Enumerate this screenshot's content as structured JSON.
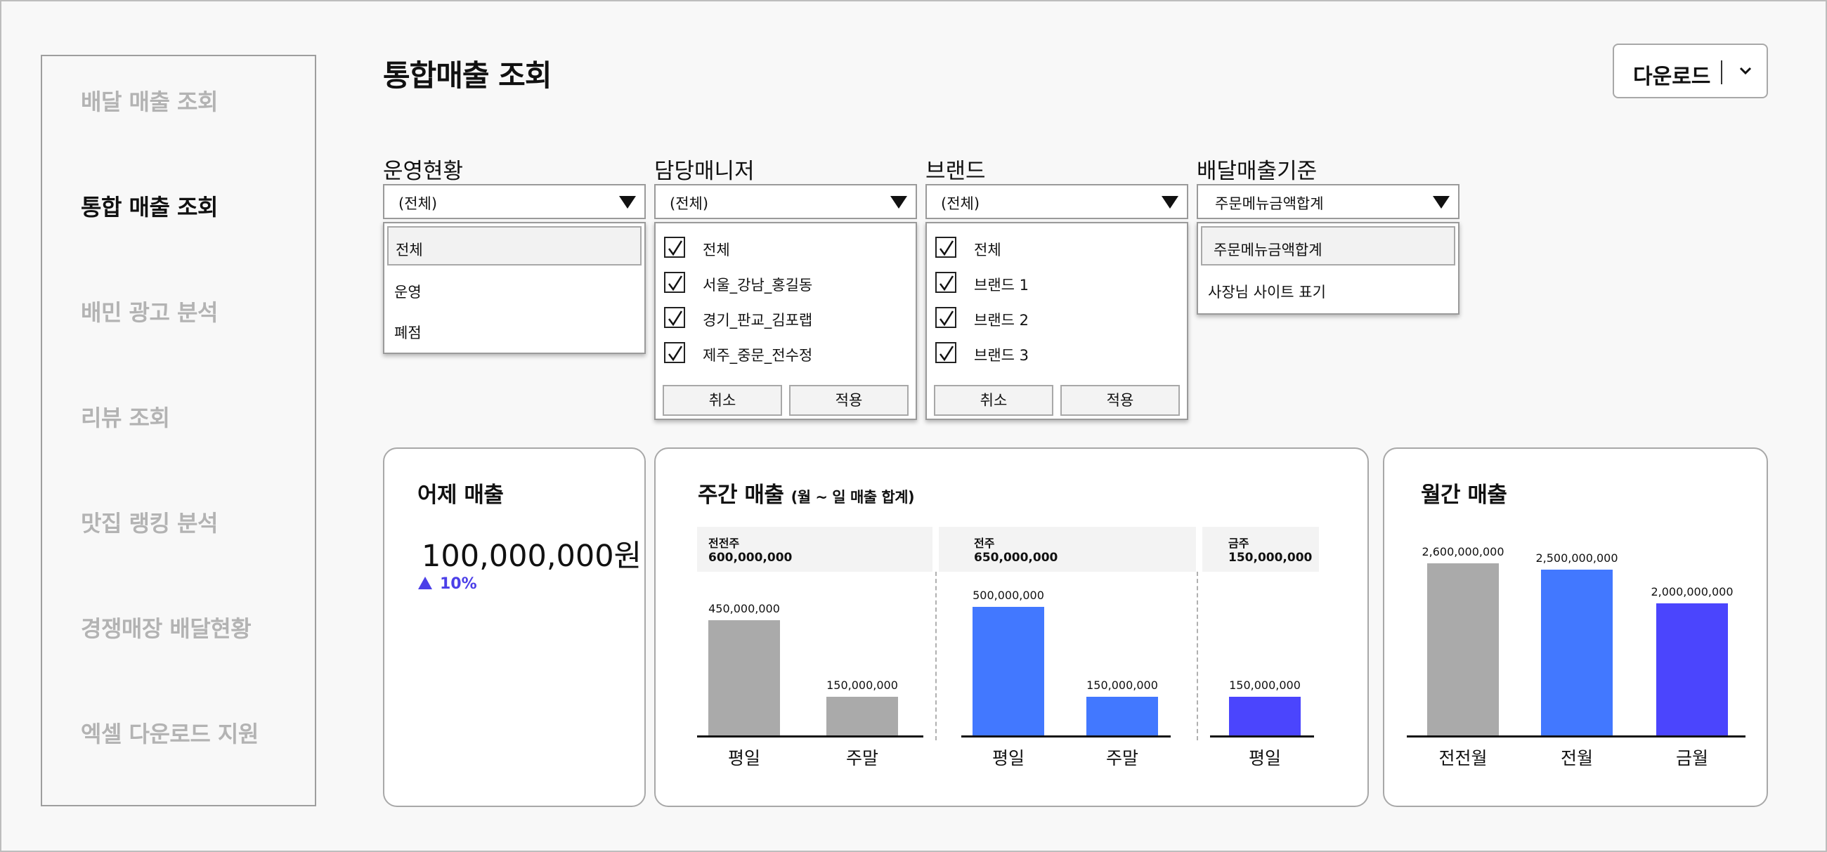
{
  "sidebar": {
    "items": [
      {
        "label": "배달 매출 조회",
        "active": false
      },
      {
        "label": "통합 매출 조회",
        "active": true
      },
      {
        "label": "배민 광고 분석",
        "active": false
      },
      {
        "label": "리뷰 조회",
        "active": false
      },
      {
        "label": "맛집 랭킹 분석",
        "active": false
      },
      {
        "label": "경쟁매장 배달현황",
        "active": false
      },
      {
        "label": "엑셀 다운로드 지원",
        "active": false
      }
    ]
  },
  "header": {
    "title": "통합매출 조회",
    "download_label": "다운로드"
  },
  "filters": {
    "status": {
      "label": "운영현황",
      "value": "(전체)",
      "options": [
        {
          "label": "전체",
          "selected": true
        },
        {
          "label": "운영",
          "selected": false
        },
        {
          "label": "폐점",
          "selected": false
        }
      ]
    },
    "manager": {
      "label": "담당매니저",
      "value": "(전체)",
      "options": [
        {
          "label": "전체",
          "checked": true
        },
        {
          "label": "서울_강남_홍길동",
          "checked": true
        },
        {
          "label": "경기_판교_김포랩",
          "checked": true
        },
        {
          "label": "제주_중문_전수정",
          "checked": true
        }
      ],
      "cancel": "취소",
      "apply": "적용"
    },
    "brand": {
      "label": "브랜드",
      "value": "(전체)",
      "options": [
        {
          "label": "전체",
          "checked": true
        },
        {
          "label": "브랜드 1",
          "checked": true
        },
        {
          "label": "브랜드 2",
          "checked": true
        },
        {
          "label": "브랜드 3",
          "checked": true
        }
      ],
      "cancel": "취소",
      "apply": "적용"
    },
    "basis": {
      "label": "배달매출기준",
      "value": "주문메뉴금액합계",
      "options": [
        {
          "label": "주문메뉴금액합계",
          "selected": true
        },
        {
          "label": "사장님 사이트 표기",
          "selected": false
        }
      ]
    }
  },
  "yesterday": {
    "title": "어제 매출",
    "value": "100,000,000원",
    "delta": "10%",
    "delta_color": "#4b3fe8"
  },
  "weekly": {
    "title": "주간 매출",
    "subtitle": "(월 ~ 일 매출 합계)",
    "groups": [
      {
        "name": "전전주",
        "total": "600,000,000"
      },
      {
        "name": "전주",
        "total": "650,000,000"
      },
      {
        "name": "금주",
        "total": "150,000,000"
      }
    ]
  },
  "monthly": {
    "title": "월간 매출"
  },
  "colors": {
    "gray": "#aaaaaa",
    "blue": "#4278ff",
    "violet": "#4b45fd"
  },
  "chart_data": [
    {
      "type": "bar",
      "title": "주간 매출",
      "categories": [
        "평일",
        "주말",
        "평일",
        "주말",
        "평일"
      ],
      "groups": [
        "전전주",
        "전전주",
        "전주",
        "전주",
        "금주"
      ],
      "values": [
        450000000,
        150000000,
        500000000,
        150000000,
        150000000
      ],
      "value_labels": [
        "450,000,000",
        "150,000,000",
        "500,000,000",
        "150,000,000",
        "150,000,000"
      ],
      "colors": [
        "#aaaaaa",
        "#aaaaaa",
        "#4278ff",
        "#4278ff",
        "#4b45fd"
      ],
      "ylim": [
        0,
        520000000
      ]
    },
    {
      "type": "bar",
      "title": "월간 매출",
      "categories": [
        "전전월",
        "전월",
        "금월"
      ],
      "values": [
        2600000000,
        2500000000,
        2000000000
      ],
      "value_labels": [
        "2,600,000,000",
        "2,500,000,000",
        "2,000,000,000"
      ],
      "colors": [
        "#aaaaaa",
        "#4278ff",
        "#4b45fd"
      ],
      "ylim": [
        0,
        2600000000
      ]
    }
  ]
}
